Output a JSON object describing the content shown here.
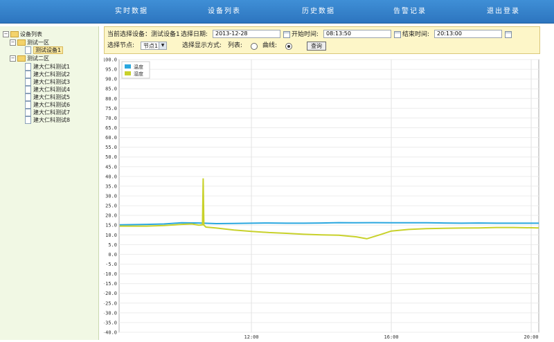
{
  "nav": {
    "items": [
      "实时数据",
      "设备列表",
      "历史数据",
      "告警记录",
      "退出登录"
    ]
  },
  "sidebar": {
    "root_label": "设备列表",
    "zone1": {
      "label": "测试一区",
      "devices": [
        "测试设备1"
      ]
    },
    "zone2": {
      "label": "测试二区",
      "devices": [
        "建大仁科测试1",
        "建大仁科测试2",
        "建大仁科测试3",
        "建大仁科测试4",
        "建大仁科测试5",
        "建大仁科测试6",
        "建大仁科测试7",
        "建大仁科测试8"
      ]
    }
  },
  "panel": {
    "current_device_label": "当前选择设备：测试设备1",
    "date_label": "选择日期:",
    "date_value": "2013-12-28",
    "start_label": "开始时间:",
    "start_value": "08:13:50",
    "end_label": "结束时间:",
    "end_value": "20:13:00",
    "node_label": "选择节点:",
    "node_value": "节点1",
    "mode_label": "选择显示方式:",
    "list_label": "列表:",
    "curve_label": "曲线:",
    "query_button": "查询"
  },
  "colors": {
    "nav_bg": "#2d75bf",
    "temperature": "#2aa7df",
    "humidity": "#c8d12a"
  },
  "chart_data": {
    "type": "line",
    "ylim": [
      -40,
      100
    ],
    "y_ticks": [
      "100.0",
      "95.0",
      "90.0",
      "85.0",
      "80.0",
      "75.0",
      "70.0",
      "65.0",
      "60.0",
      "55.0",
      "50.0",
      "45.0",
      "40.0",
      "35.0",
      "30.0",
      "25.0",
      "20.0",
      "15.0",
      "10.0",
      "5.0",
      "0.0",
      "-5.0",
      "-10.0",
      "-15.0",
      "-20.0",
      "-25.0",
      "-30.0",
      "-35.0",
      "-40.0"
    ],
    "x_range": [
      "08:13",
      "20:13"
    ],
    "x_ticks": [
      {
        "label": "12:00",
        "t": 12.0
      },
      {
        "label": "16:00",
        "t": 16.0
      },
      {
        "label": "20:00",
        "t": 20.0
      }
    ],
    "grid": true,
    "legend_position": "top-left",
    "series": [
      {
        "name": "温度",
        "x": [
          8.23,
          9.0,
          9.5,
          10.0,
          10.5,
          11.0,
          11.5,
          12.0,
          12.5,
          13.0,
          13.5,
          14.0,
          14.5,
          15.0,
          15.5,
          16.0,
          16.5,
          17.0,
          17.5,
          18.0,
          18.5,
          19.0,
          19.5,
          20.22
        ],
        "values": [
          15.2,
          15.4,
          15.6,
          16.2,
          16.1,
          15.8,
          15.9,
          16.0,
          16.1,
          16.0,
          16.0,
          16.1,
          16.3,
          16.2,
          16.3,
          16.2,
          16.2,
          16.2,
          16.1,
          16.0,
          16.1,
          16.0,
          16.0,
          16.0
        ]
      },
      {
        "name": "湿度",
        "x": [
          8.23,
          9.0,
          9.5,
          10.0,
          10.3,
          10.5,
          10.6,
          10.62,
          10.64,
          10.7,
          11.0,
          11.5,
          12.0,
          12.5,
          13.0,
          13.5,
          14.0,
          14.5,
          15.0,
          15.3,
          15.7,
          16.0,
          16.5,
          17.0,
          17.5,
          18.0,
          18.5,
          19.0,
          19.5,
          20.22
        ],
        "values": [
          14.5,
          14.5,
          14.8,
          15.4,
          15.6,
          15.0,
          15.2,
          39.0,
          15.0,
          14.0,
          13.5,
          12.5,
          11.8,
          11.2,
          10.8,
          10.3,
          10.0,
          9.8,
          9.0,
          8.0,
          10.2,
          12.0,
          12.8,
          13.2,
          13.4,
          13.5,
          13.6,
          13.8,
          13.8,
          13.6
        ]
      }
    ]
  }
}
